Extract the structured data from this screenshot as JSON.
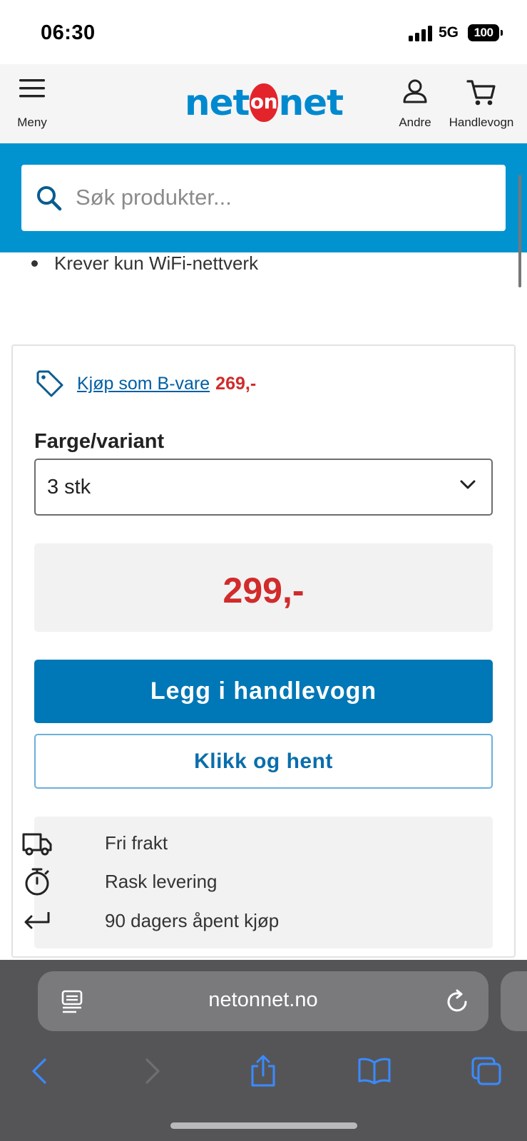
{
  "status_bar": {
    "time": "06:30",
    "network": "5G",
    "battery": "100"
  },
  "header": {
    "menu_label": "Meny",
    "logo": {
      "left": "net",
      "middle": "on",
      "right": "net"
    },
    "account_label": "Andre",
    "cart_label": "Handlevogn"
  },
  "search": {
    "placeholder": "Søk produkter..."
  },
  "product": {
    "feature_line": "Krever kun WiFi-nettverk",
    "b_item": {
      "link_text": "Kjøp som B-vare",
      "price": "269,-"
    },
    "variant": {
      "label": "Farge/variant",
      "selected": "3 stk"
    },
    "price": "299,-",
    "add_to_cart_label": "Legg i handlevogn",
    "click_collect_label": "Klikk og hent",
    "usps": [
      {
        "icon": "truck-icon",
        "text": "Fri frakt"
      },
      {
        "icon": "stopwatch-icon",
        "text": "Rask levering"
      },
      {
        "icon": "return-arrow-icon",
        "text": "90 dagers åpent kjøp"
      }
    ]
  },
  "browser": {
    "url": "netonnet.no"
  },
  "colors": {
    "brand_blue": "#0093d0",
    "button_blue": "#0077b6",
    "price_red": "#d12b2b",
    "logo_red": "#e3242b"
  }
}
